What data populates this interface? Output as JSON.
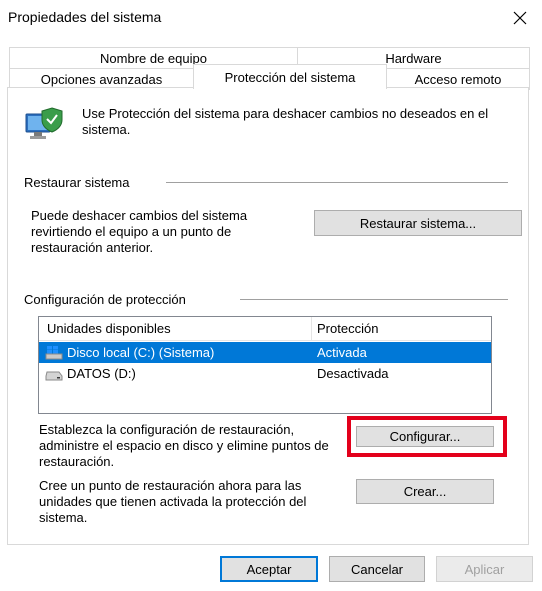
{
  "window": {
    "title": "Propiedades del sistema",
    "close_icon": "close-icon"
  },
  "tabs": {
    "row1": [
      {
        "label": "Nombre de equipo"
      },
      {
        "label": "Hardware"
      }
    ],
    "row2": [
      {
        "label": "Opciones avanzadas"
      },
      {
        "label": "Protección del sistema",
        "selected": true
      },
      {
        "label": "Acceso remoto"
      }
    ]
  },
  "intro": {
    "icon": "computer-shield-icon",
    "text": "Use Protección del sistema para deshacer cambios no deseados en el sistema."
  },
  "restore": {
    "group_label": "Restaurar sistema",
    "description": "Puede deshacer cambios del sistema revirtiendo el equipo a un punto de restauración anterior.",
    "button_label": "Restaurar sistema..."
  },
  "protection": {
    "group_label": "Configuración de protección",
    "columns": [
      "Unidades disponibles",
      "Protección"
    ],
    "drives": [
      {
        "name": "Disco local (C:) (Sistema)",
        "status": "Activada",
        "icon": "windows-drive-icon",
        "selected": true
      },
      {
        "name": "DATOS (D:)",
        "status": "Desactivada",
        "icon": "drive-icon",
        "selected": false
      }
    ],
    "configure_text": "Establezca la configuración de restauración, administre el espacio en disco y elimine puntos de restauración.",
    "configure_label": "Configurar...",
    "create_text": "Cree un punto de restauración ahora para las unidades que tienen activada la protección del sistema.",
    "create_label": "Crear..."
  },
  "footer": {
    "ok_label": "Aceptar",
    "cancel_label": "Cancelar",
    "apply_label": "Aplicar"
  },
  "colors": {
    "selection": "#0078d7",
    "highlight_box": "#e3001b"
  }
}
